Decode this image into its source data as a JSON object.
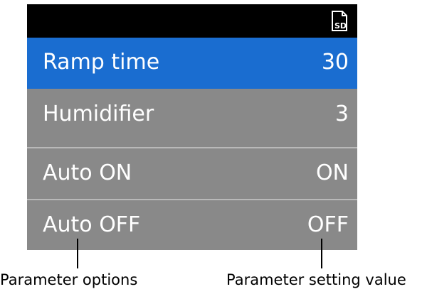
{
  "status_bar": {
    "icon": "sd-card-icon"
  },
  "menu": {
    "items": [
      {
        "label": "Ramp time",
        "value": "30",
        "selected": true
      },
      {
        "label": "Humidifier",
        "value": "3"
      },
      {
        "label": "Auto ON",
        "value": "ON"
      },
      {
        "label": "Auto OFF",
        "value": "OFF"
      }
    ]
  },
  "captions": {
    "left": "Parameter options",
    "right": "Parameter setting value"
  },
  "colors": {
    "selected_row": "#1a6dd0",
    "row_background": "#898989",
    "status_bar": "#000000"
  }
}
